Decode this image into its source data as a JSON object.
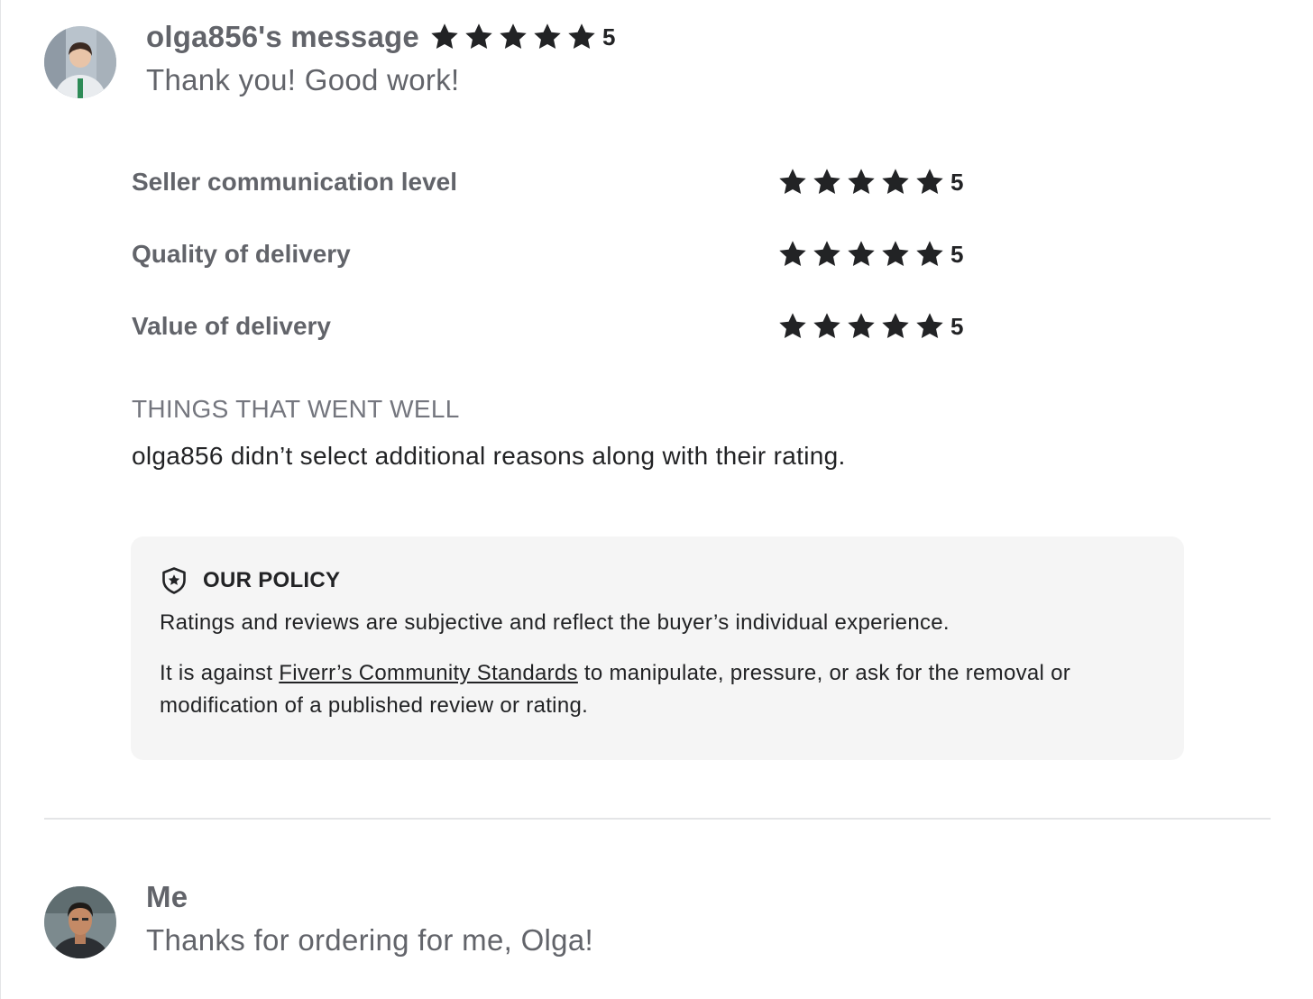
{
  "review": {
    "username": "olga856's message",
    "overall_rating": "5",
    "message": "Thank you! Good work!",
    "ratings": [
      {
        "label": "Seller communication level",
        "value": "5"
      },
      {
        "label": "Quality of delivery",
        "value": "5"
      },
      {
        "label": "Value of delivery",
        "value": "5"
      }
    ],
    "went_well_title": "THINGS THAT WENT WELL",
    "went_well_text": "olga856 didn’t select additional reasons along with their rating."
  },
  "policy": {
    "icon": "shield-star-icon",
    "title": "OUR POLICY",
    "paragraph1": "Ratings and reviews are subjective and reflect the buyer’s individual experience.",
    "paragraph2_before": "It is against ",
    "link_text": "Fiverr’s Community Standards",
    "paragraph2_after": " to manipulate, pressure, or ask for the removal or modification of a published review or rating."
  },
  "reply": {
    "username": "Me",
    "message": "Thanks for ordering for me, Olga!"
  },
  "colors": {
    "star": "#222325",
    "policy_bg": "#f5f5f5",
    "divider": "#e4e5e7"
  }
}
